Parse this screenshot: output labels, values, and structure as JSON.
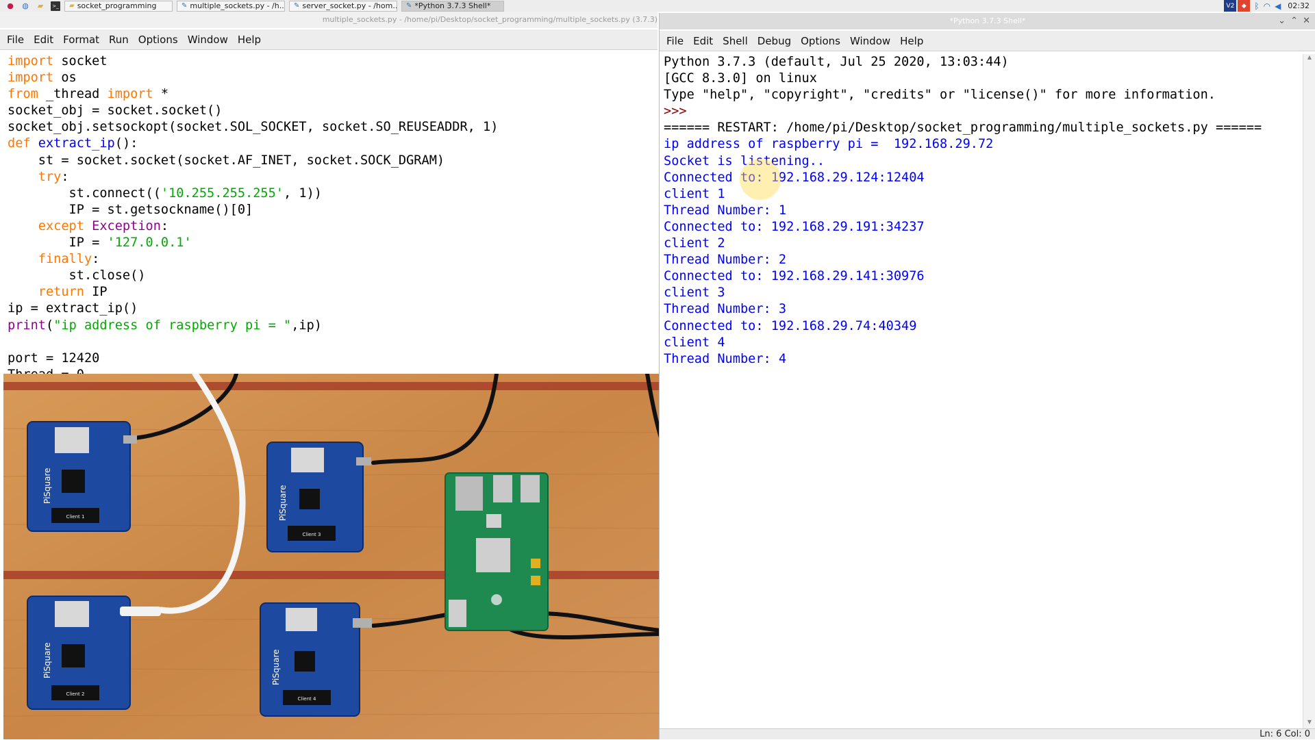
{
  "taskbar": {
    "tasks": [
      {
        "label": "socket_programming"
      },
      {
        "label": "multiple_sockets.py - /h..."
      },
      {
        "label": "server_socket.py - /hom..."
      },
      {
        "label": "*Python 3.7.3 Shell*"
      }
    ],
    "tray": {
      "vnc": "V2",
      "clock": "02:32"
    }
  },
  "editor": {
    "title": "multiple_sockets.py - /home/pi/Desktop/socket_programming/multiple_sockets.py (3.7.3)",
    "menu": [
      "File",
      "Edit",
      "Format",
      "Run",
      "Options",
      "Window",
      "Help"
    ],
    "code": [
      [
        {
          "t": "import",
          "c": "kw"
        },
        {
          "t": " socket"
        }
      ],
      [
        {
          "t": "import",
          "c": "kw"
        },
        {
          "t": " os"
        }
      ],
      [
        {
          "t": "from",
          "c": "kw"
        },
        {
          "t": " _thread "
        },
        {
          "t": "import",
          "c": "kw"
        },
        {
          "t": " *"
        }
      ],
      [
        {
          "t": "socket_obj = socket.socket()"
        }
      ],
      [
        {
          "t": "socket_obj.setsockopt(socket.SOL_SOCKET, socket.SO_REUSEADDR, 1)"
        }
      ],
      [
        {
          "t": "def",
          "c": "kw"
        },
        {
          "t": " "
        },
        {
          "t": "extract_ip",
          "c": "fn"
        },
        {
          "t": "():"
        }
      ],
      [
        {
          "t": "    st = socket.socket(socket.AF_INET, socket.SOCK_DGRAM)"
        }
      ],
      [
        {
          "t": "    "
        },
        {
          "t": "try",
          "c": "kw"
        },
        {
          "t": ":"
        }
      ],
      [
        {
          "t": "        st.connect(("
        },
        {
          "t": "'10.255.255.255'",
          "c": "st"
        },
        {
          "t": ", 1))"
        }
      ],
      [
        {
          "t": "        IP = st.getsockname()[0]"
        }
      ],
      [
        {
          "t": "    "
        },
        {
          "t": "except",
          "c": "kw"
        },
        {
          "t": " "
        },
        {
          "t": "Exception",
          "c": "bi"
        },
        {
          "t": ":"
        }
      ],
      [
        {
          "t": "        IP = "
        },
        {
          "t": "'127.0.0.1'",
          "c": "st"
        }
      ],
      [
        {
          "t": "    "
        },
        {
          "t": "finally",
          "c": "kw"
        },
        {
          "t": ":"
        }
      ],
      [
        {
          "t": "        st.close()"
        }
      ],
      [
        {
          "t": "    "
        },
        {
          "t": "return",
          "c": "kw"
        },
        {
          "t": " IP"
        }
      ],
      [
        {
          "t": "ip = extract_ip()"
        }
      ],
      [
        {
          "t": "print",
          "c": "bi"
        },
        {
          "t": "("
        },
        {
          "t": "\"ip address of raspberry pi = \"",
          "c": "st"
        },
        {
          "t": ",ip)"
        }
      ],
      [
        {
          "t": ""
        }
      ],
      [
        {
          "t": "port = 12420"
        }
      ],
      [
        {
          "t": "Thread = 0"
        }
      ]
    ]
  },
  "shell": {
    "title": "*Python 3.7.3 Shell*",
    "menu": [
      "File",
      "Edit",
      "Shell",
      "Debug",
      "Options",
      "Window",
      "Help"
    ],
    "lines": [
      {
        "t": "Python 3.7.3 (default, Jul 25 2020, 13:03:44)",
        "c": "plain"
      },
      {
        "t": "[GCC 8.3.0] on linux",
        "c": "plain"
      },
      {
        "t": "Type \"help\", \"copyright\", \"credits\" or \"license()\" for more information.",
        "c": "plain"
      },
      {
        "t": ">>> ",
        "c": "prompt"
      },
      {
        "t": "====== RESTART: /home/pi/Desktop/socket_programming/multiple_sockets.py ======",
        "c": "plain"
      },
      {
        "t": "ip address of raspberry pi =  192.168.29.72",
        "c": "out"
      },
      {
        "t": "Socket is listening..",
        "c": "out"
      },
      {
        "t": "Connected to: 192.168.29.124:12404",
        "c": "out"
      },
      {
        "t": "client 1",
        "c": "out"
      },
      {
        "t": "Thread Number: 1",
        "c": "out"
      },
      {
        "t": "Connected to: 192.168.29.191:34237",
        "c": "out"
      },
      {
        "t": "client 2",
        "c": "out"
      },
      {
        "t": "Thread Number: 2",
        "c": "out"
      },
      {
        "t": "Connected to: 192.168.29.141:30976",
        "c": "out"
      },
      {
        "t": "client 3",
        "c": "out"
      },
      {
        "t": "Thread Number: 3",
        "c": "out"
      },
      {
        "t": "Connected to: 192.168.29.74:40349",
        "c": "out"
      },
      {
        "t": "client 4",
        "c": "out"
      },
      {
        "t": "Thread Number: 4",
        "c": "out"
      }
    ],
    "status": "Ln: 6  Col: 0"
  },
  "photo": {
    "boards": [
      {
        "brand": "PiSquare",
        "oled": "Client 1"
      },
      {
        "brand": "PiSquare",
        "oled": "Client 3"
      },
      {
        "brand": "PiSquare",
        "oled": "Client 2"
      },
      {
        "brand": "PiSquare",
        "oled": "Client 4"
      }
    ]
  }
}
